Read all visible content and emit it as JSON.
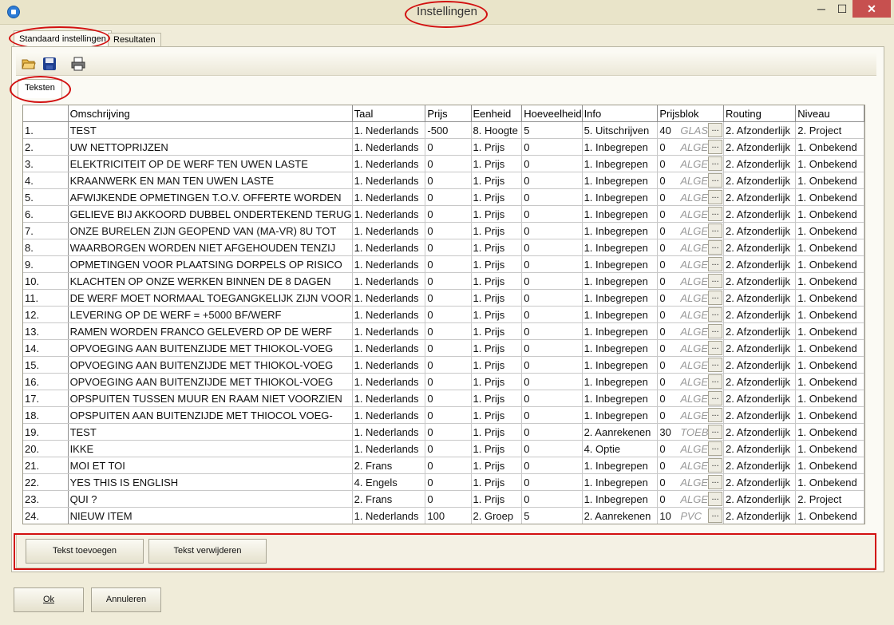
{
  "window": {
    "title": "Instellingen",
    "minimize": "─",
    "maximize": "☐",
    "close": "✕"
  },
  "tabs": [
    "Standaard instellingen",
    "Resultaten"
  ],
  "subtab": "Teksten",
  "columns": [
    "",
    "Omschrijving",
    "Taal",
    "Prijs",
    "Eenheid",
    "Hoeveelheid",
    "Info",
    "Prijsblok",
    "Routing",
    "Niveau"
  ],
  "rows": [
    [
      "1.",
      "TEST",
      "1. Nederlands",
      "-500",
      "8. Hoogte",
      "5",
      "5. Uitschrijven",
      "40",
      "GLAS",
      "2. Afzonderlijk",
      "2. Project"
    ],
    [
      "2.",
      "UW NETTOPRIJZEN",
      "1. Nederlands",
      "0",
      "1. Prijs",
      "0",
      "1. Inbegrepen",
      "0",
      "ALGEM",
      "2. Afzonderlijk",
      "1. Onbekend"
    ],
    [
      "3.",
      "ELEKTRICITEIT OP DE WERF TEN UWEN LASTE",
      "1. Nederlands",
      "0",
      "1. Prijs",
      "0",
      "1. Inbegrepen",
      "0",
      "ALGEM",
      "2. Afzonderlijk",
      "1. Onbekend"
    ],
    [
      "4.",
      "KRAANWERK EN MAN TEN UWEN LASTE",
      "1. Nederlands",
      "0",
      "1. Prijs",
      "0",
      "1. Inbegrepen",
      "0",
      "ALGEM",
      "2. Afzonderlijk",
      "1. Onbekend"
    ],
    [
      "5.",
      "AFWIJKENDE OPMETINGEN T.O.V. OFFERTE WORDEN",
      "1. Nederlands",
      "0",
      "1. Prijs",
      "0",
      "1. Inbegrepen",
      "0",
      "ALGEM",
      "2. Afzonderlijk",
      "1. Onbekend"
    ],
    [
      "6.",
      "GELIEVE BIJ AKKOORD DUBBEL ONDERTEKEND TERUG",
      "1. Nederlands",
      "0",
      "1. Prijs",
      "0",
      "1. Inbegrepen",
      "0",
      "ALGEM",
      "2. Afzonderlijk",
      "1. Onbekend"
    ],
    [
      "7.",
      "ONZE BURELEN ZIJN GEOPEND VAN (MA-VR) 8U TOT",
      "1. Nederlands",
      "0",
      "1. Prijs",
      "0",
      "1. Inbegrepen",
      "0",
      "ALGEM",
      "2. Afzonderlijk",
      "1. Onbekend"
    ],
    [
      "8.",
      "WAARBORGEN WORDEN NIET AFGEHOUDEN TENZIJ",
      "1. Nederlands",
      "0",
      "1. Prijs",
      "0",
      "1. Inbegrepen",
      "0",
      "ALGEM",
      "2. Afzonderlijk",
      "1. Onbekend"
    ],
    [
      "9.",
      "OPMETINGEN VOOR PLAATSING DORPELS OP RISICO",
      "1. Nederlands",
      "0",
      "1. Prijs",
      "0",
      "1. Inbegrepen",
      "0",
      "ALGEM",
      "2. Afzonderlijk",
      "1. Onbekend"
    ],
    [
      "10.",
      "KLACHTEN OP ONZE WERKEN BINNEN DE 8 DAGEN",
      "1. Nederlands",
      "0",
      "1. Prijs",
      "0",
      "1. Inbegrepen",
      "0",
      "ALGEM",
      "2. Afzonderlijk",
      "1. Onbekend"
    ],
    [
      "11.",
      "DE WERF MOET NORMAAL TOEGANGKELIJK ZIJN VOOR",
      "1. Nederlands",
      "0",
      "1. Prijs",
      "0",
      "1. Inbegrepen",
      "0",
      "ALGEM",
      "2. Afzonderlijk",
      "1. Onbekend"
    ],
    [
      "12.",
      "LEVERING OP DE WERF = +5000 BF/WERF",
      "1. Nederlands",
      "0",
      "1. Prijs",
      "0",
      "1. Inbegrepen",
      "0",
      "ALGEM",
      "2. Afzonderlijk",
      "1. Onbekend"
    ],
    [
      "13.",
      "RAMEN WORDEN FRANCO GELEVERD OP DE WERF",
      "1. Nederlands",
      "0",
      "1. Prijs",
      "0",
      "1. Inbegrepen",
      "0",
      "ALGEM",
      "2. Afzonderlijk",
      "1. Onbekend"
    ],
    [
      "14.",
      "OPVOEGING AAN BUITENZIJDE MET THIOKOL-VOEG",
      "1. Nederlands",
      "0",
      "1. Prijs",
      "0",
      "1. Inbegrepen",
      "0",
      "ALGEM",
      "2. Afzonderlijk",
      "1. Onbekend"
    ],
    [
      "15.",
      "OPVOEGING AAN BUITENZIJDE MET THIOKOL-VOEG",
      "1. Nederlands",
      "0",
      "1. Prijs",
      "0",
      "1. Inbegrepen",
      "0",
      "ALGEM",
      "2. Afzonderlijk",
      "1. Onbekend"
    ],
    [
      "16.",
      "OPVOEGING AAN BUITENZIJDE MET THIOKOL-VOEG",
      "1. Nederlands",
      "0",
      "1. Prijs",
      "0",
      "1. Inbegrepen",
      "0",
      "ALGEM",
      "2. Afzonderlijk",
      "1. Onbekend"
    ],
    [
      "17.",
      "OPSPUITEN TUSSEN MUUR EN RAAM NIET VOORZIEN",
      "1. Nederlands",
      "0",
      "1. Prijs",
      "0",
      "1. Inbegrepen",
      "0",
      "ALGEM",
      "2. Afzonderlijk",
      "1. Onbekend"
    ],
    [
      "18.",
      "OPSPUITEN AAN BUITENZIJDE MET THIOCOL VOEG-",
      "1. Nederlands",
      "0",
      "1. Prijs",
      "0",
      "1. Inbegrepen",
      "0",
      "ALGEM",
      "2. Afzonderlijk",
      "1. Onbekend"
    ],
    [
      "19.",
      "TEST",
      "1. Nederlands",
      "0",
      "1. Prijs",
      "0",
      "2. Aanrekenen",
      "30",
      "TOEB",
      "2. Afzonderlijk",
      "1. Onbekend"
    ],
    [
      "20.",
      "IKKE",
      "1. Nederlands",
      "0",
      "1. Prijs",
      "0",
      "4. Optie",
      "0",
      "ALGEM",
      "2. Afzonderlijk",
      "1. Onbekend"
    ],
    [
      "21.",
      "MOI ET TOI",
      "2. Frans",
      "0",
      "1. Prijs",
      "0",
      "1. Inbegrepen",
      "0",
      "ALGEM",
      "2. Afzonderlijk",
      "1. Onbekend"
    ],
    [
      "22.",
      "YES THIS IS ENGLISH",
      "4. Engels",
      "0",
      "1. Prijs",
      "0",
      "1. Inbegrepen",
      "0",
      "ALGEM",
      "2. Afzonderlijk",
      "1. Onbekend"
    ],
    [
      "23.",
      "QUI ?",
      "2. Frans",
      "0",
      "1. Prijs",
      "0",
      "1. Inbegrepen",
      "0",
      "ALGEM",
      "2. Afzonderlijk",
      "2. Project"
    ],
    [
      "24.",
      "NIEUW ITEM",
      "1. Nederlands",
      "100",
      "2. Groep",
      "5",
      "2. Aanrekenen",
      "10",
      "PVC",
      "2. Afzonderlijk",
      "1. Onbekend"
    ]
  ],
  "ellipsis": "...",
  "buttons": {
    "add_text": "Tekst toevoegen",
    "remove_text": "Tekst verwijderen",
    "ok": "Ok",
    "cancel": "Annuleren"
  },
  "icons": [
    "folder-open-icon",
    "save-disk-icon",
    "printer-icon"
  ],
  "colors": {
    "highlight_red": "#d21010",
    "window_bg": "#f0ecd9",
    "close_red": "#c7504f"
  }
}
